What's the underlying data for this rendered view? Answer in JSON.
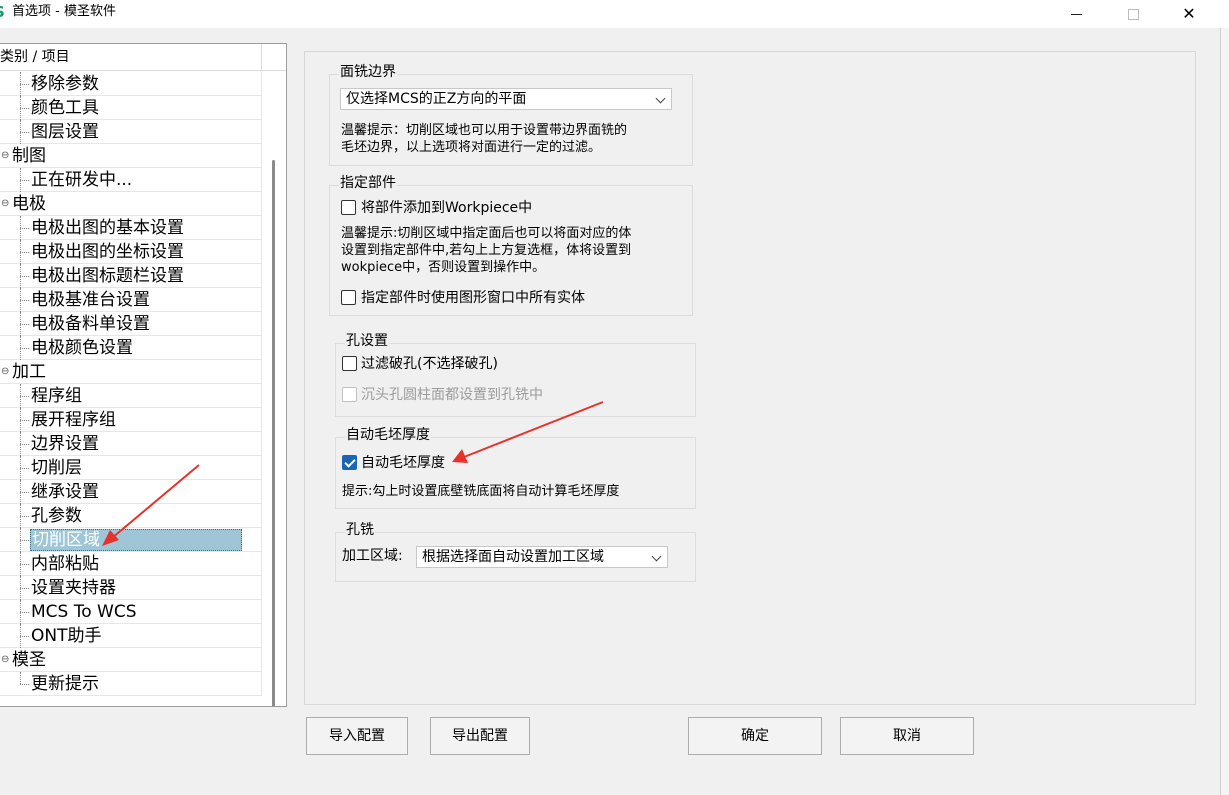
{
  "window": {
    "app_icon": "S",
    "title": "首选项 - 模圣软件",
    "minimize_icon": "minimize-icon",
    "maximize_icon": "maximize-icon",
    "close_icon": "close-icon",
    "close_glyph": "✕"
  },
  "tree": {
    "header": "类别 / 项目",
    "rows": [
      {
        "label": "移除参数",
        "level": "child"
      },
      {
        "label": "颜色工具",
        "level": "child"
      },
      {
        "label": "图层设置",
        "level": "child"
      },
      {
        "label": "制图",
        "level": "parent",
        "toggle": "⊖"
      },
      {
        "label": "正在研发中...",
        "level": "child"
      },
      {
        "label": "电极",
        "level": "parent",
        "toggle": "⊖"
      },
      {
        "label": "电极出图的基本设置",
        "level": "child"
      },
      {
        "label": "电极出图的坐标设置",
        "level": "child"
      },
      {
        "label": "电极出图标题栏设置",
        "level": "child"
      },
      {
        "label": "电极基准台设置",
        "level": "child"
      },
      {
        "label": "电极备料单设置",
        "level": "child"
      },
      {
        "label": "电极颜色设置",
        "level": "child"
      },
      {
        "label": "加工",
        "level": "parent",
        "toggle": "⊖"
      },
      {
        "label": "程序组",
        "level": "child"
      },
      {
        "label": "展开程序组",
        "level": "child"
      },
      {
        "label": "边界设置",
        "level": "child"
      },
      {
        "label": "切削层",
        "level": "child"
      },
      {
        "label": "继承设置",
        "level": "child"
      },
      {
        "label": "孔参数",
        "level": "child"
      },
      {
        "label": "切削区域",
        "level": "child",
        "selected": true
      },
      {
        "label": "内部粘贴",
        "level": "child"
      },
      {
        "label": "设置夹持器",
        "level": "child"
      },
      {
        "label": "MCS To WCS",
        "level": "child"
      },
      {
        "label": "ONT助手",
        "level": "child"
      },
      {
        "label": "模圣",
        "level": "parent",
        "toggle": "⊖"
      },
      {
        "label": "更新提示",
        "level": "child"
      }
    ]
  },
  "groups": {
    "face_mill_boundary": {
      "title": "面铣边界",
      "combo_value": "仅选择MCS的正Z方向的平面",
      "hint_line1": "温馨提示：切削区域也可以用于设置带边界面铣的",
      "hint_line2": "毛坯边界，以上选项将对面进行一定的过滤。"
    },
    "specify_part": {
      "title": "指定部件",
      "checkbox1_label": "将部件添加到Workpiece中",
      "checkbox1_checked": false,
      "hint_line1": "温馨提示:切削区域中指定面后也可以将面对应的体",
      "hint_line2": "设置到指定部件中,若勾上上方复选框，体将设置到",
      "hint_line3": "wokpiece中，否则设置到操作中。",
      "checkbox2_label": "指定部件时使用图形窗口中所有实体",
      "checkbox2_checked": false
    },
    "hole_settings": {
      "title": "孔设置",
      "checkbox1_label": "过滤破孔(不选择破孔)",
      "checkbox1_checked": false,
      "checkbox2_label": "沉头孔圆柱面都设置到孔铣中",
      "checkbox2_checked": false,
      "checkbox2_disabled": true
    },
    "auto_blank": {
      "title": "自动毛坯厚度",
      "checkbox_label": "自动毛坯厚度",
      "checkbox_checked": true,
      "hint": "提示:勾上时设置底壁铣底面将自动计算毛坯厚度"
    },
    "hole_milling": {
      "title": "孔铣",
      "field_label": "加工区域:",
      "combo_value": "根据选择面自动设置加工区域"
    }
  },
  "buttons": {
    "import": "导入配置",
    "export": "导出配置",
    "ok": "确定",
    "cancel": "取消"
  },
  "colors": {
    "selection": "#9ec6d6",
    "checkbox_checked": "#1a66b5",
    "annotation_arrow": "#e8312a"
  }
}
